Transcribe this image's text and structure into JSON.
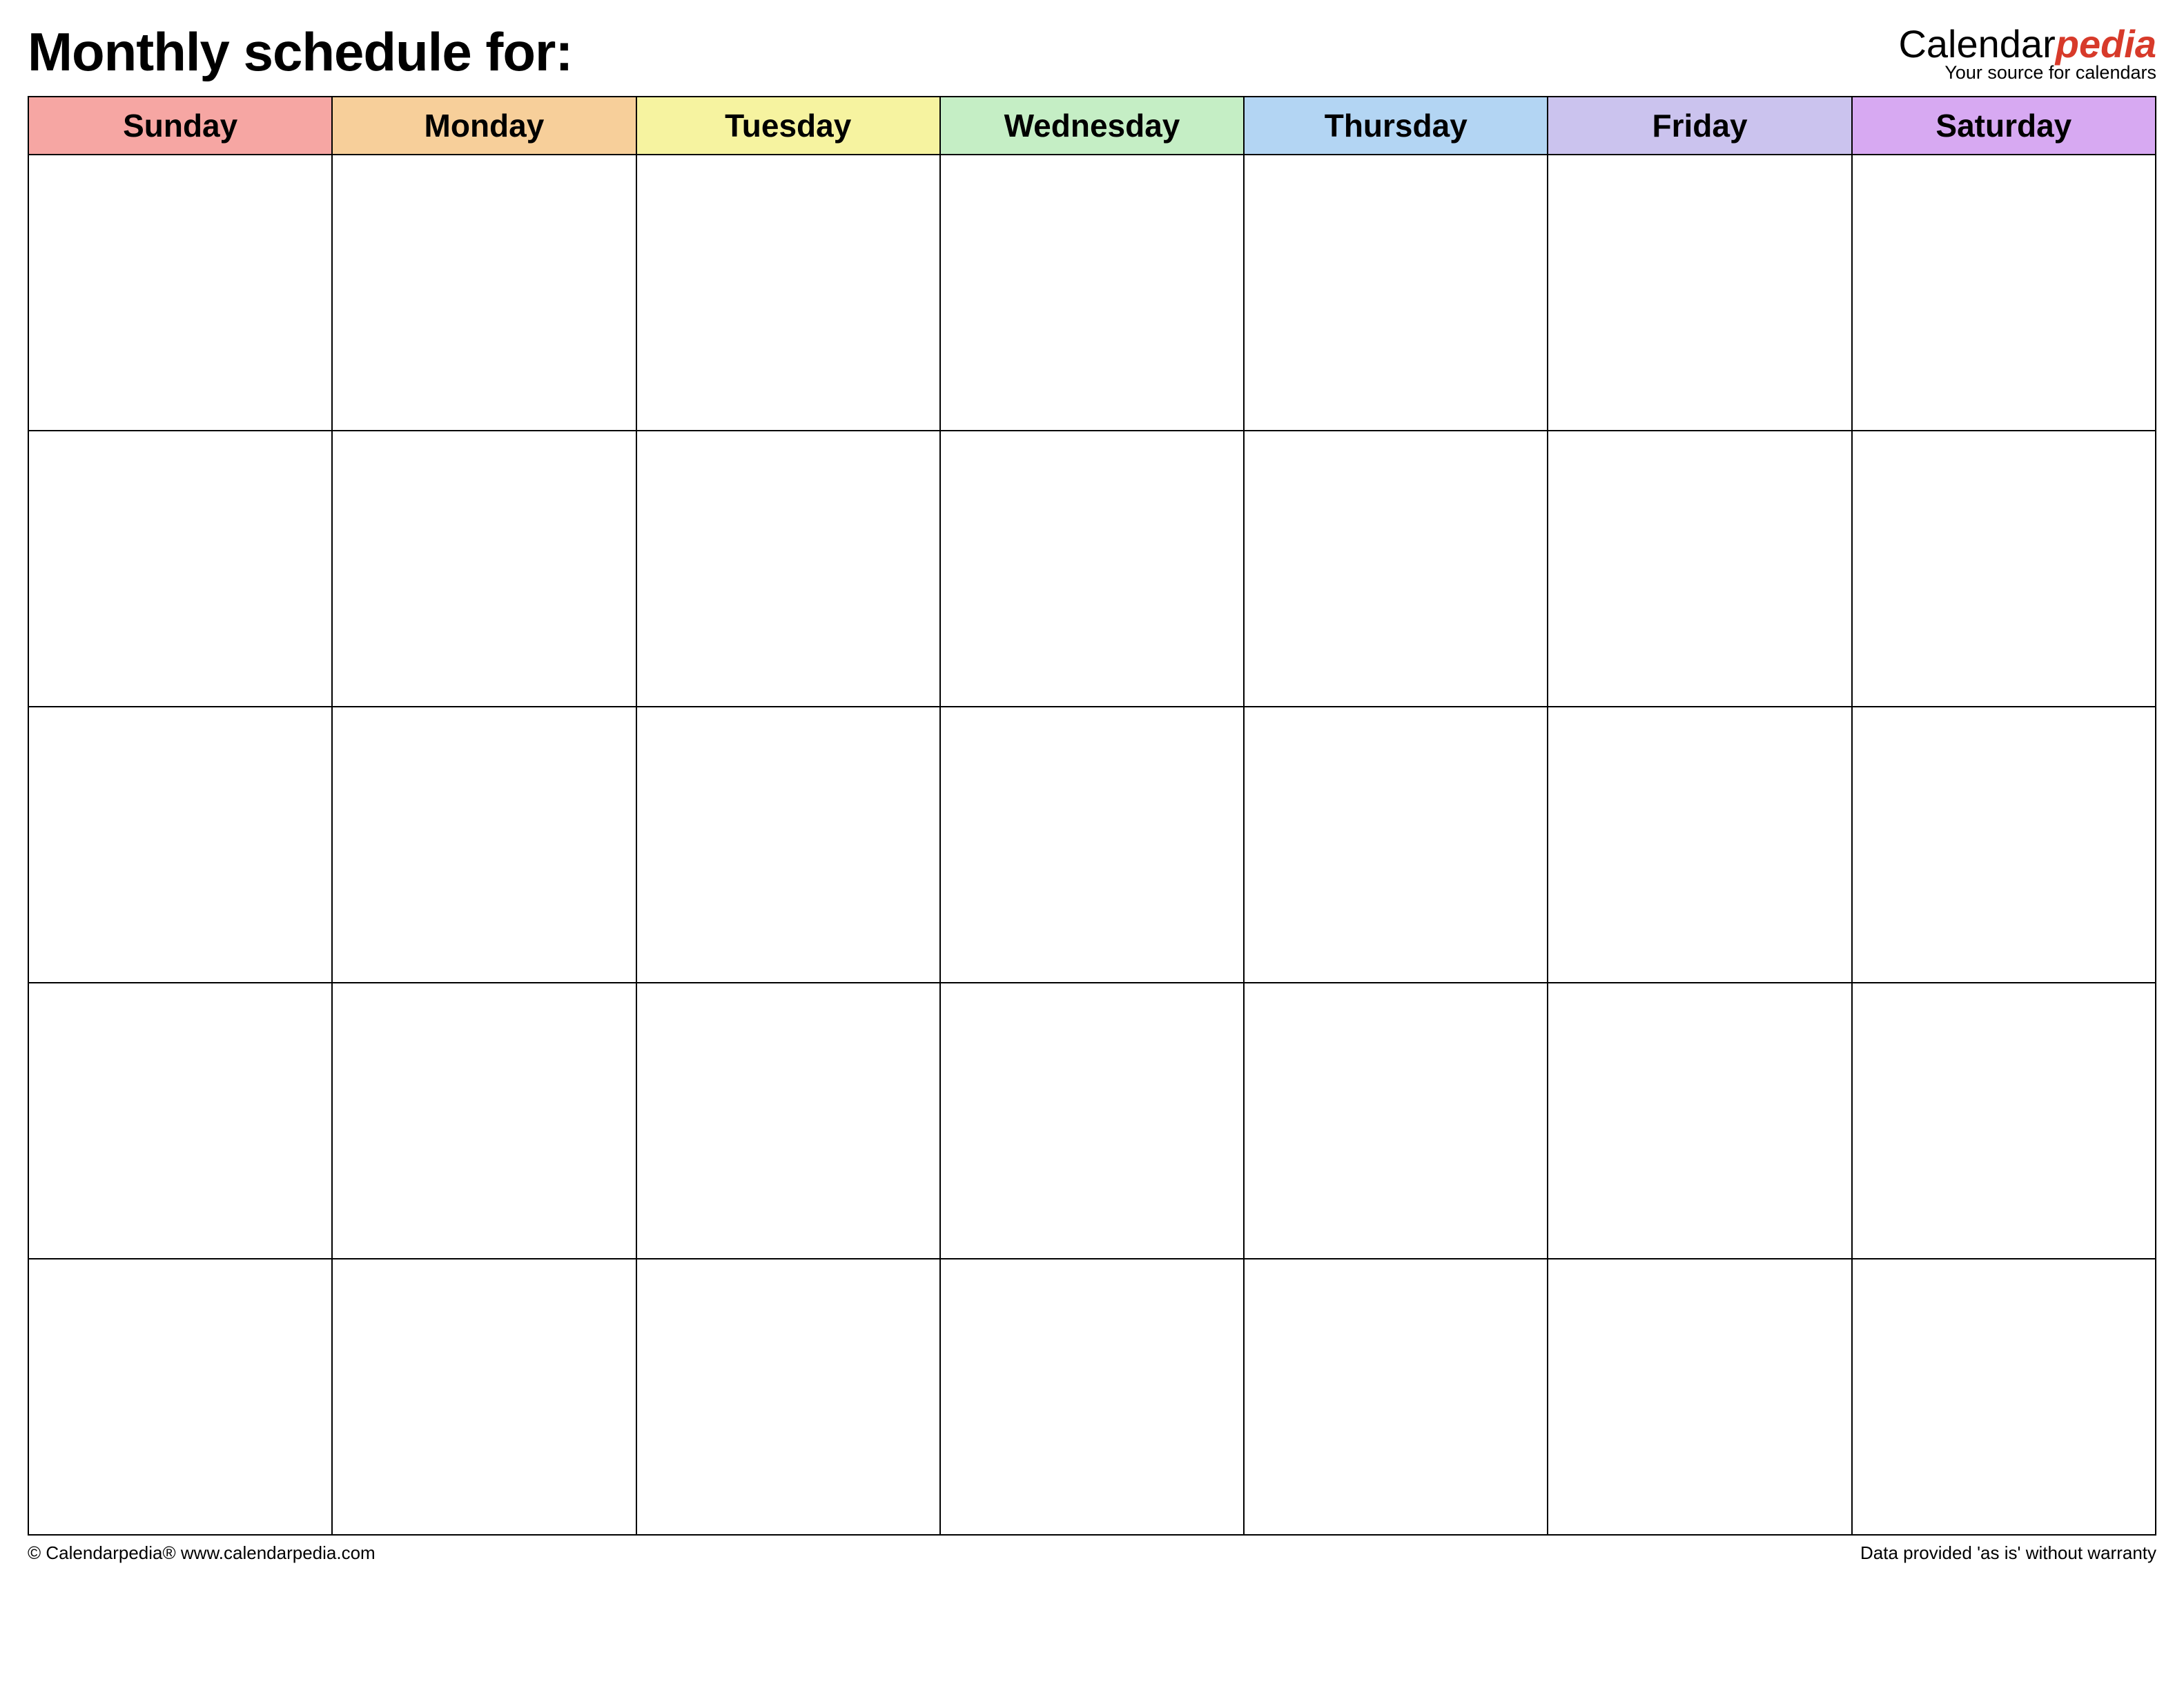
{
  "title": "Monthly schedule for:",
  "logo": {
    "part1": "Calendar",
    "part2": "pedia",
    "tagline": "Your source for calendars"
  },
  "days": [
    {
      "label": "Sunday",
      "color": "#f6a6a3"
    },
    {
      "label": "Monday",
      "color": "#f7cf9a"
    },
    {
      "label": "Tuesday",
      "color": "#f6f3a0"
    },
    {
      "label": "Wednesday",
      "color": "#c5eec5"
    },
    {
      "label": "Thursday",
      "color": "#b3d5f3"
    },
    {
      "label": "Friday",
      "color": "#cbc3ee"
    },
    {
      "label": "Saturday",
      "color": "#d7a9f2"
    }
  ],
  "rows": 5,
  "footer": {
    "left": "© Calendarpedia®   www.calendarpedia.com",
    "right": "Data provided 'as is' without warranty"
  }
}
